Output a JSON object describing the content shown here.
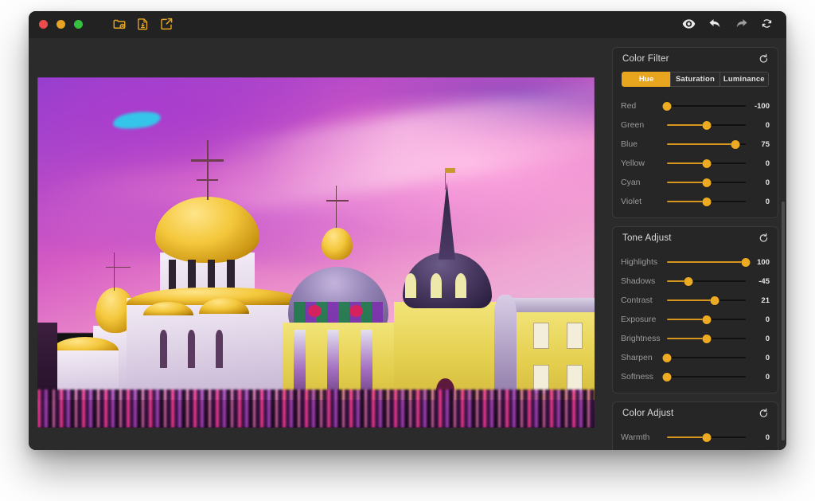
{
  "window": {
    "traffic_lights": [
      "close",
      "minimize",
      "maximize"
    ],
    "toolbar_left": [
      {
        "name": "add-image-icon",
        "label": "Add Image"
      },
      {
        "name": "save-document-icon",
        "label": "Save"
      },
      {
        "name": "share-export-icon",
        "label": "Export"
      }
    ],
    "toolbar_right": [
      {
        "name": "preview-eye-icon",
        "label": "Preview"
      },
      {
        "name": "undo-icon",
        "label": "Undo"
      },
      {
        "name": "redo-icon",
        "label": "Redo"
      },
      {
        "name": "reset-all-icon",
        "label": "Reset"
      }
    ]
  },
  "colors": {
    "accent": "#e8a51e",
    "slider_fill": "#d79620",
    "thumb": "#edab24",
    "panel_bg": "#262626",
    "window_bg": "#2b2b2b",
    "titlebar_bg": "#222222"
  },
  "canvas": {
    "image_alt": "Orthodox monastery with golden onion domes under a magenta and purple color-graded sky"
  },
  "panels": [
    {
      "id": "color-filter",
      "title": "Color Filter",
      "reset_label": "Reset",
      "tabs": [
        {
          "label": "Hue",
          "active": true
        },
        {
          "label": "Saturation",
          "active": false
        },
        {
          "label": "Luminance",
          "active": false
        }
      ],
      "sliders": [
        {
          "label": "Red",
          "value": "-100",
          "pct": 0,
          "min": -100,
          "max": 100
        },
        {
          "label": "Green",
          "value": "0",
          "pct": 50,
          "min": -100,
          "max": 100
        },
        {
          "label": "Blue",
          "value": "75",
          "pct": 87,
          "min": -100,
          "max": 100
        },
        {
          "label": "Yellow",
          "value": "0",
          "pct": 50,
          "min": -100,
          "max": 100
        },
        {
          "label": "Cyan",
          "value": "0",
          "pct": 50,
          "min": -100,
          "max": 100
        },
        {
          "label": "Violet",
          "value": "0",
          "pct": 50,
          "min": -100,
          "max": 100
        }
      ]
    },
    {
      "id": "tone-adjust",
      "title": "Tone Adjust",
      "reset_label": "Reset",
      "tabs": [],
      "sliders": [
        {
          "label": "Highlights",
          "value": "100",
          "pct": 100,
          "min": -100,
          "max": 100
        },
        {
          "label": "Shadows",
          "value": "-45",
          "pct": 27,
          "min": -100,
          "max": 100
        },
        {
          "label": "Contrast",
          "value": "21",
          "pct": 61,
          "min": -100,
          "max": 100
        },
        {
          "label": "Exposure",
          "value": "0",
          "pct": 50,
          "min": -100,
          "max": 100
        },
        {
          "label": "Brightness",
          "value": "0",
          "pct": 50,
          "min": -100,
          "max": 100
        },
        {
          "label": "Sharpen",
          "value": "0",
          "pct": 0,
          "min": 0,
          "max": 100
        },
        {
          "label": "Softness",
          "value": "0",
          "pct": 0,
          "min": 0,
          "max": 100
        }
      ]
    },
    {
      "id": "color-adjust",
      "title": "Color Adjust",
      "reset_label": "Reset",
      "tabs": [],
      "sliders": [
        {
          "label": "Warmth",
          "value": "0",
          "pct": 50,
          "min": -100,
          "max": 100
        }
      ]
    }
  ]
}
